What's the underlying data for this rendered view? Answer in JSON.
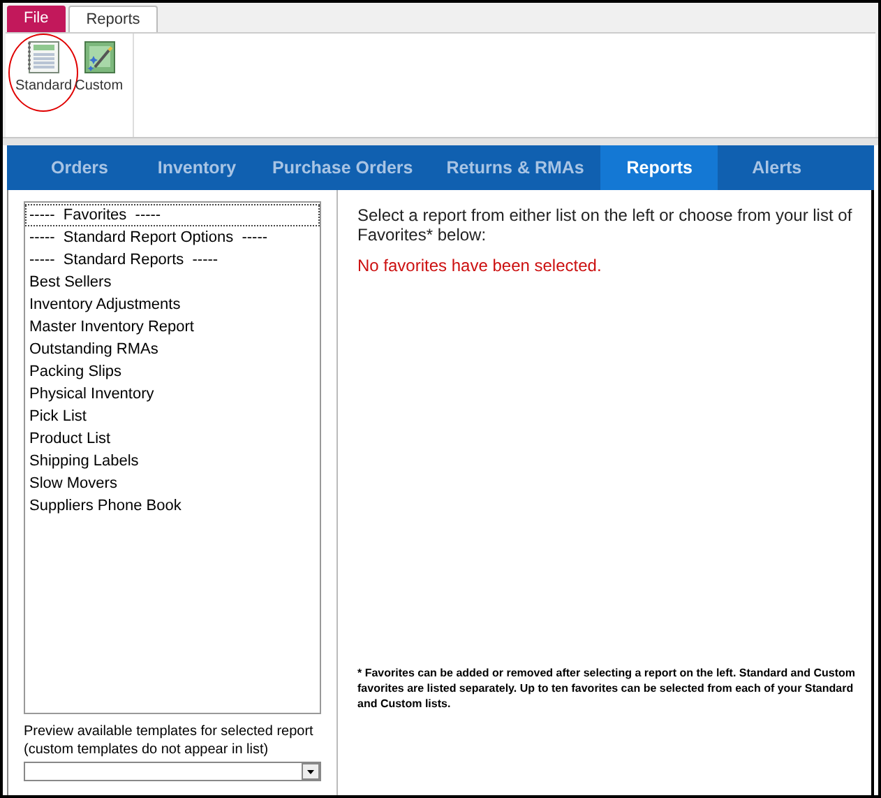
{
  "ribbon_tabs": [
    {
      "label": "File",
      "kind": "file",
      "selected": false
    },
    {
      "label": "Reports",
      "kind": "tab",
      "selected": true
    }
  ],
  "ribbon_buttons": [
    {
      "label": "Standard",
      "kind": "standard",
      "highlighted": true
    },
    {
      "label": "Custom",
      "kind": "custom",
      "highlighted": false
    }
  ],
  "nav_tabs": [
    {
      "label": "Orders",
      "selected": false
    },
    {
      "label": "Inventory",
      "selected": false
    },
    {
      "label": "Purchase Orders",
      "selected": false
    },
    {
      "label": "Returns & RMAs",
      "selected": false
    },
    {
      "label": "Reports",
      "selected": true
    },
    {
      "label": "Alerts",
      "selected": false
    }
  ],
  "report_list": [
    {
      "label": "-----  Favorites  -----",
      "selected": true
    },
    {
      "label": "-----  Standard Report Options  -----",
      "selected": false
    },
    {
      "label": "-----  Standard Reports  -----",
      "selected": false
    },
    {
      "label": "Best Sellers",
      "selected": false
    },
    {
      "label": "Inventory Adjustments",
      "selected": false
    },
    {
      "label": "Master Inventory Report",
      "selected": false
    },
    {
      "label": "Outstanding RMAs",
      "selected": false
    },
    {
      "label": "Packing Slips",
      "selected": false
    },
    {
      "label": "Physical Inventory",
      "selected": false
    },
    {
      "label": "Pick List",
      "selected": false
    },
    {
      "label": "Product List",
      "selected": false
    },
    {
      "label": "Shipping Labels",
      "selected": false
    },
    {
      "label": "Slow Movers",
      "selected": false
    },
    {
      "label": "Suppliers Phone Book",
      "selected": false
    }
  ],
  "template_label": "Preview available templates for selected report (custom templates do not appear in list)",
  "instructions": "Select a report from either list on the left or choose from your list of Favorites* below:",
  "no_favorites": "No favorites have been selected.",
  "footnote": "* Favorites can be added or removed after selecting a report on the left.  Standard and Custom favorites are listed separately.  Up to ten favorites can be selected from each of your Standard and Custom lists."
}
